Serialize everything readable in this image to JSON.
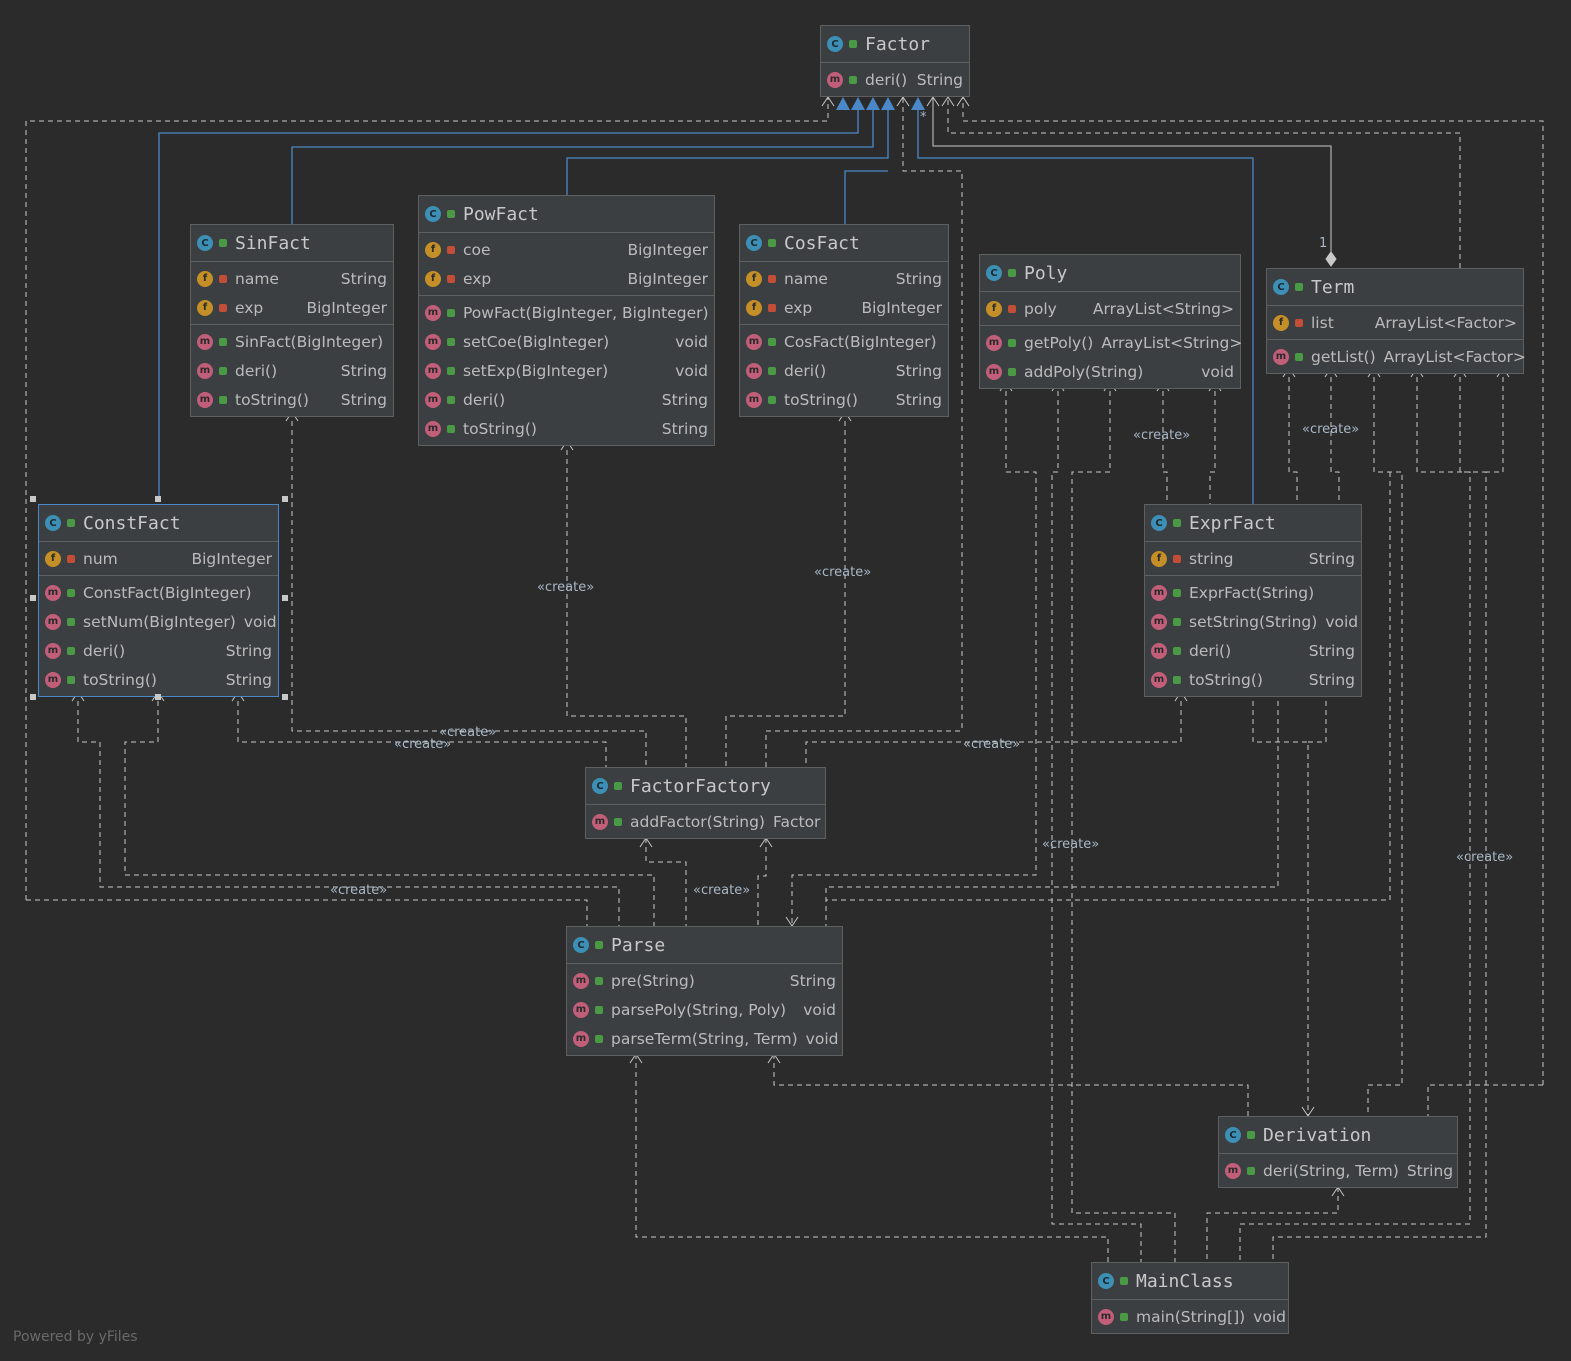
{
  "colors": {
    "background": "#2b2b2b",
    "node": "#3c3f41",
    "realization": "#4a88c7",
    "dependency": "#c8c8c8"
  },
  "classes": {
    "factor": {
      "name": "Factor",
      "members": [
        {
          "kind": "m",
          "name": "deri()",
          "type": "String"
        }
      ]
    },
    "sinfact": {
      "name": "SinFact",
      "fields": [
        {
          "name": "name",
          "type": "String"
        },
        {
          "name": "exp",
          "type": "BigInteger"
        }
      ],
      "methods": [
        {
          "name": "SinFact(BigInteger)",
          "type": ""
        },
        {
          "name": "deri()",
          "type": "String"
        },
        {
          "name": "toString()",
          "type": "String"
        }
      ]
    },
    "powfact": {
      "name": "PowFact",
      "fields": [
        {
          "name": "coe",
          "type": "BigInteger"
        },
        {
          "name": "exp",
          "type": "BigInteger"
        }
      ],
      "methods": [
        {
          "name": "PowFact(BigInteger, BigInteger)",
          "type": ""
        },
        {
          "name": "setCoe(BigInteger)",
          "type": "void"
        },
        {
          "name": "setExp(BigInteger)",
          "type": "void"
        },
        {
          "name": "deri()",
          "type": "String"
        },
        {
          "name": "toString()",
          "type": "String"
        }
      ]
    },
    "cosfact": {
      "name": "CosFact",
      "fields": [
        {
          "name": "name",
          "type": "String"
        },
        {
          "name": "exp",
          "type": "BigInteger"
        }
      ],
      "methods": [
        {
          "name": "CosFact(BigInteger)",
          "type": ""
        },
        {
          "name": "deri()",
          "type": "String"
        },
        {
          "name": "toString()",
          "type": "String"
        }
      ]
    },
    "poly": {
      "name": "Poly",
      "fields": [
        {
          "name": "poly",
          "type": "ArrayList<String>"
        }
      ],
      "methods": [
        {
          "name": "getPoly()",
          "type": "ArrayList<String>"
        },
        {
          "name": "addPoly(String)",
          "type": "void"
        }
      ]
    },
    "term": {
      "name": "Term",
      "fields": [
        {
          "name": "list",
          "type": "ArrayList<Factor>"
        }
      ],
      "methods": [
        {
          "name": "getList()",
          "type": "ArrayList<Factor>"
        }
      ]
    },
    "constfact": {
      "name": "ConstFact",
      "fields": [
        {
          "name": "num",
          "type": "BigInteger"
        }
      ],
      "methods": [
        {
          "name": "ConstFact(BigInteger)",
          "type": ""
        },
        {
          "name": "setNum(BigInteger)",
          "type": "void"
        },
        {
          "name": "deri()",
          "type": "String"
        },
        {
          "name": "toString()",
          "type": "String"
        }
      ]
    },
    "exprfact": {
      "name": "ExprFact",
      "fields": [
        {
          "name": "string",
          "type": "String"
        }
      ],
      "methods": [
        {
          "name": "ExprFact(String)",
          "type": ""
        },
        {
          "name": "setString(String)",
          "type": "void"
        },
        {
          "name": "deri()",
          "type": "String"
        },
        {
          "name": "toString()",
          "type": "String"
        }
      ]
    },
    "factorfactory": {
      "name": "FactorFactory",
      "methods": [
        {
          "name": "addFactor(String)",
          "type": "Factor"
        }
      ]
    },
    "parse": {
      "name": "Parse",
      "methods": [
        {
          "name": "pre(String)",
          "type": "String"
        },
        {
          "name": "parsePoly(String, Poly)",
          "type": "void"
        },
        {
          "name": "parseTerm(String, Term)",
          "type": "void"
        }
      ]
    },
    "derivation": {
      "name": "Derivation",
      "methods": [
        {
          "name": "deri(String, Term)",
          "type": "String"
        }
      ]
    },
    "mainclass": {
      "name": "MainClass",
      "methods": [
        {
          "name": "main(String[])",
          "type": "void"
        }
      ]
    }
  },
  "edge_labels": [
    "«create»",
    "«create»",
    "«create»",
    "«create»",
    "«create»",
    "«create»",
    "«create»",
    "«create»",
    "«create»",
    "«create»",
    "«create»"
  ],
  "multiplicity": {
    "one": "1",
    "many": "*"
  },
  "footer": "Powered by yFiles"
}
